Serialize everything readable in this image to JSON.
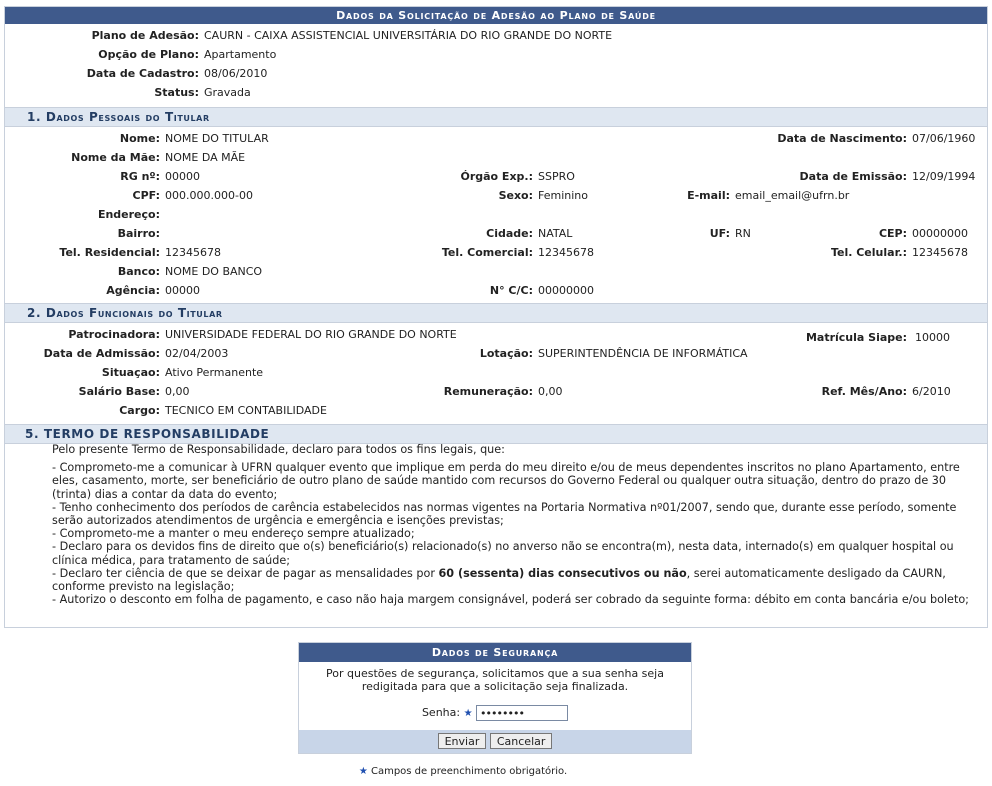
{
  "main": {
    "title": "Dados da Solicitação de Adesão ao Plano de Saúde",
    "fields": [
      {
        "label": "Plano de Adesão:",
        "value": "CAURN - CAIXA ASSISTENCIAL UNIVERSITÁRIA DO RIO GRANDE DO NORTE"
      },
      {
        "label": "Opção de Plano:",
        "value": "Apartamento"
      },
      {
        "label": "Data de Cadastro:",
        "value": "08/06/2010"
      },
      {
        "label": "Status:",
        "value": "Gravada"
      }
    ]
  },
  "pessoais": {
    "title": "1. Dados Pessoais do Titular",
    "nome_label": "Nome:",
    "nome": "NOME DO TITULAR",
    "nasc_label": "Data de Nascimento:",
    "nasc": "07/06/1960",
    "mae_label": "Nome da Mãe:",
    "mae": "NOME DA MÃE",
    "rg_label": "RG nº:",
    "rg": "00000",
    "orgao_label": "Órgão Exp.:",
    "orgao": "SSPRO",
    "emissao_label": "Data de Emissão:",
    "emissao": "12/09/1994",
    "cpf_label": "CPF:",
    "cpf": "000.000.000-00",
    "sexo_label": "Sexo:",
    "sexo": "Feminino",
    "email_label": "E-mail:",
    "email": "email_email@ufrn.br",
    "endereco_label": "Endereço:",
    "bairro_label": "Bairro:",
    "cidade_label": "Cidade:",
    "cidade": "NATAL",
    "uf_label": "UF:",
    "uf": "RN",
    "cep_label": "CEP:",
    "cep": "00000000",
    "telres_label": "Tel. Residencial:",
    "telres": "12345678",
    "telcom_label": "Tel. Comercial:",
    "telcom": "12345678",
    "telcel_label": "Tel. Celular.:",
    "telcel": "12345678",
    "banco_label": "Banco:",
    "banco": "NOME DO BANCO",
    "agencia_label": "Agência:",
    "agencia": "00000",
    "cc_label": "N° C/C:",
    "cc": "00000000"
  },
  "funcionais": {
    "title": "2. Dados Funcionais do Titular",
    "patroc_label": "Patrocinadora:",
    "patroc": "UNIVERSIDADE FEDERAL DO RIO GRANDE DO NORTE",
    "matricula_label": "Matrícula Siape:",
    "matricula": "10000",
    "admissao_label": "Data de Admissão:",
    "admissao": "02/04/2003",
    "lotacao_label": "Lotação:",
    "lotacao": "SUPERINTENDÊNCIA DE INFORMÁTICA",
    "situacao_label": "Situaçao:",
    "situacao": "Ativo Permanente",
    "salario_label": "Salário Base:",
    "salario": "0,00",
    "remun_label": "Remuneração:",
    "remun": "0,00",
    "ref_label": "Ref. Mês/Ano:",
    "ref": "6/2010",
    "cargo_label": "Cargo:",
    "cargo": "TECNICO EM CONTABILIDADE"
  },
  "termo": {
    "title": "5. Termo de Responsabilidade",
    "intro": "Pelo presente Termo de Responsabilidade, declaro para todos os fins legais, que:",
    "l1": "- Comprometo-me a comunicar à UFRN qualquer evento que implique em perda do meu direito e/ou de meus dependentes inscritos no plano Apartamento, entre eles, casamento, morte, ser beneficiário de outro plano de saúde mantido com recursos do Governo Federal ou qualquer outra situação, dentro do prazo de 30 (trinta) dias a contar da data do evento;",
    "l2": "- Tenho conhecimento dos períodos de carência estabelecidos nas normas vigentes na Portaria Normativa nº01/2007, sendo que, durante esse período, somente serão autorizados atendimentos de urgência e emergência e isenções previstas;",
    "l3": "- Comprometo-me a manter o meu endereço sempre atualizado;",
    "l4": "- Declaro para os devidos fins de direito que o(s) beneficiário(s) relacionado(s) no anverso não se encontra(m), nesta data, internado(s) em qualquer hospital ou clínica médica, para tratamento de saúde;",
    "l5a": "- Declaro ter ciência de que se deixar de pagar as mensalidades por ",
    "l5b": "60 (sessenta) dias consecutivos ou não",
    "l5c": ", serei automaticamente desligado da CAURN, conforme previsto na legislação;",
    "l6": "- Autorizo o desconto em folha de pagamento, e caso não haja margem consignável, poderá ser cobrado da seguinte forma: débito em conta bancária e/ou boleto;"
  },
  "seguranca": {
    "title": "Dados de Segurança",
    "msg1": "Por questões de segurança, solicitamos que a sua senha seja",
    "msg2": "redigitada para que a solicitação seja finalizada.",
    "senha_label": "Senha:",
    "senha_value": "••••••••",
    "enviar": "Enviar",
    "cancelar": "Cancelar"
  },
  "mandatory_note": "Campos de preenchimento obrigatório.",
  "colors": {
    "caption_bg": "#3f5a8c",
    "subcaption_bg": "#dfe7f1",
    "footer_bg": "#c8d5e8"
  }
}
